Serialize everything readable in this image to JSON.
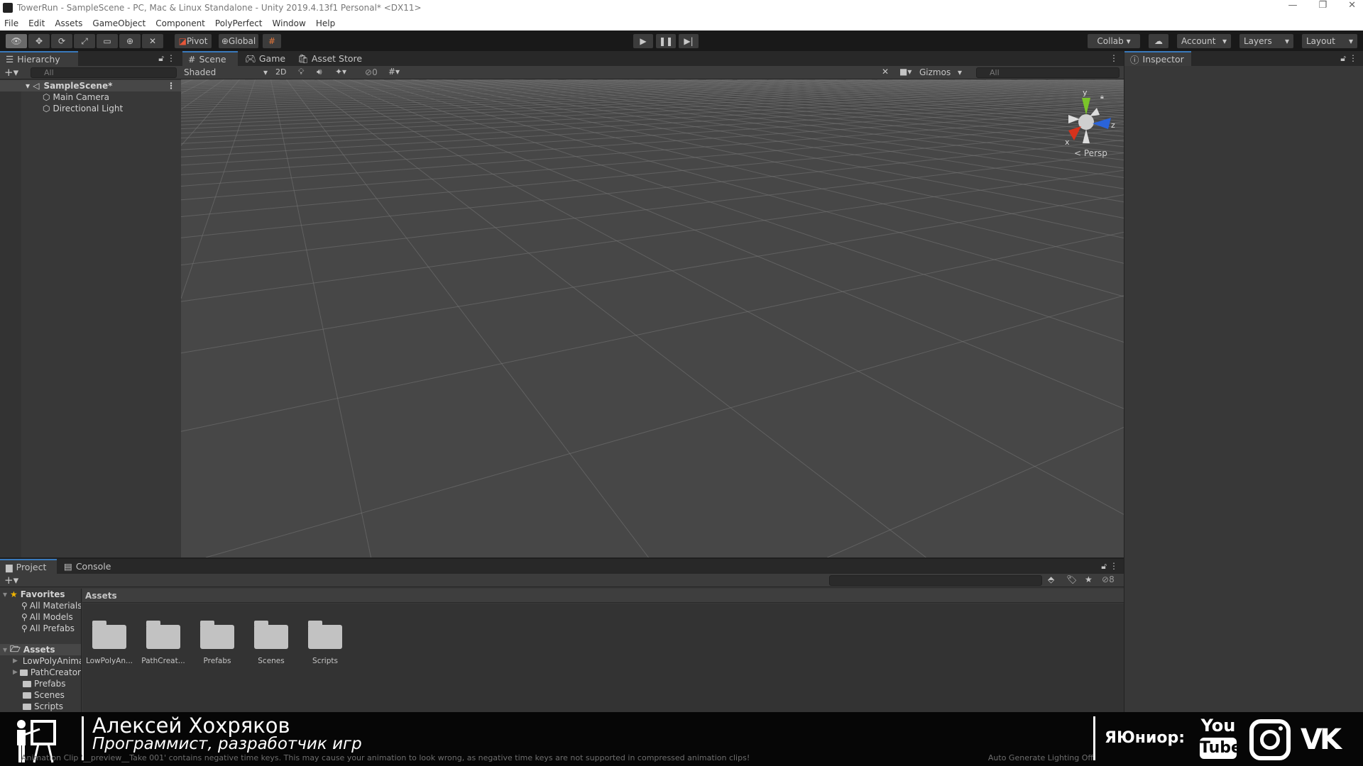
{
  "window": {
    "title": "TowerRun - SampleScene - PC, Mac & Linux Standalone - Unity 2019.4.13f1 Personal* <DX11>",
    "controls": [
      "—",
      "❐",
      "✕"
    ]
  },
  "menu": [
    "File",
    "Edit",
    "Assets",
    "GameObject",
    "Component",
    "PolyPerfect",
    "Window",
    "Help"
  ],
  "toolbar": {
    "pivot": "Pivot",
    "global": "Global",
    "collab": "Collab ▾",
    "account": "Account",
    "layers": "Layers",
    "layout": "Layout"
  },
  "hierarchy": {
    "tab": "Hierarchy",
    "search_placeholder": "All",
    "scene": "SampleScene*",
    "items": [
      "Main Camera",
      "Directional Light"
    ]
  },
  "scene": {
    "tabs": [
      "Scene",
      "Game",
      "Asset Store"
    ],
    "shading": "Shaded",
    "mode_2d": "2D",
    "hidden_count": "0",
    "gizmos": "Gizmos",
    "search_placeholder": "All",
    "projection": "Persp",
    "axes": {
      "x": "x",
      "y": "y",
      "z": "z"
    },
    "colors": {
      "x": "#d7321c",
      "y": "#7bc42a",
      "z": "#2a63d9",
      "background": "#474747"
    }
  },
  "inspector": {
    "tab": "Inspector"
  },
  "project": {
    "tabs": [
      "Project",
      "Console"
    ],
    "hidden_count": "8",
    "breadcrumb": "Assets",
    "favorites": {
      "label": "Favorites",
      "items": [
        "All Materials",
        "All Models",
        "All Prefabs"
      ]
    },
    "assets_tree": {
      "label": "Assets",
      "items": [
        "LowPolyAnimals",
        "PathCreator",
        "Prefabs",
        "Scenes",
        "Scripts"
      ]
    },
    "grid": [
      "LowPolyAn...",
      "PathCreat...",
      "Prefabs",
      "Scenes",
      "Scripts"
    ]
  },
  "status": {
    "message": "Animation Clip '__preview__Take 001' contains negative time keys. This may cause your animation to look wrong, as negative time keys are not supported in compressed animation clips!",
    "lighting": "Auto Generate Lighting Off"
  },
  "overlay": {
    "name": "Алексей Хохряков",
    "role": "Программист, разработчик игр",
    "brand": "ЯЮниор:",
    "youtube_top": "You",
    "youtube_bottom": "Tube",
    "vk": "VK"
  }
}
